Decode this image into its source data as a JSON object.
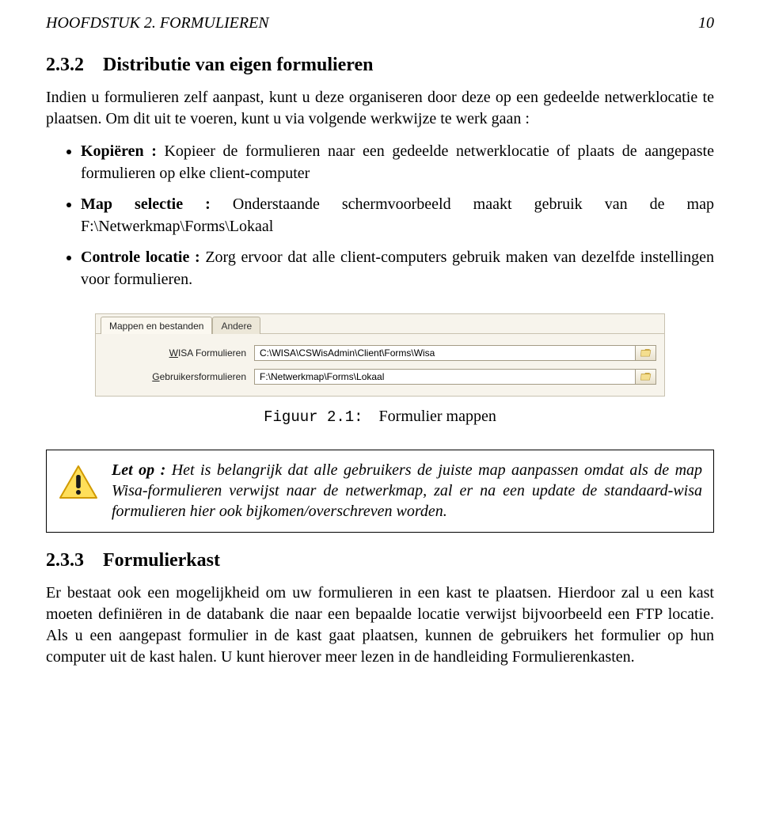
{
  "header": {
    "chapter": "HOOFDSTUK 2. FORMULIEREN",
    "page_number": "10"
  },
  "section_232": {
    "number": "2.3.2",
    "title": "Distributie van eigen formulieren",
    "intro": "Indien u formulieren zelf aanpast, kunt u deze organiseren door deze op een gedeelde netwerklocatie te plaatsen. Om dit uit te voeren, kunt u via volgende werkwijze te werk gaan :",
    "bullets": [
      {
        "label": "Kopiëren :",
        "text": " Kopieer de formulieren naar een gedeelde netwerklocatie of plaats de aangepaste formulieren op elke client-computer"
      },
      {
        "label": "Map selectie :",
        "text": " Onderstaande schermvoorbeeld maakt gebruik van de map F:\\Netwerkmap\\Forms\\Lokaal"
      },
      {
        "label": "Controle locatie :",
        "text": " Zorg ervoor dat alle client-computers gebruik maken van dezelfde instellingen voor formulieren."
      }
    ]
  },
  "screenshot": {
    "tabs": [
      "Mappen en bestanden",
      "Andere"
    ],
    "rows": [
      {
        "label_raw": "WISA Formulieren",
        "label_prefix": "W",
        "label_rest": "ISA Formulieren",
        "value": "C:\\WISA\\CSWisAdmin\\Client\\Forms\\Wisa"
      },
      {
        "label_raw": "Gebruikersformulieren",
        "label_prefix": "G",
        "label_rest": "ebruikersformulieren",
        "value": "F:\\Netwerkmap\\Forms\\Lokaal"
      }
    ]
  },
  "caption": {
    "figure": "Figuur 2.1:",
    "text": "Formulier mappen"
  },
  "warning": {
    "label": "Let op :",
    "text": " Het is belangrijk dat alle gebruikers de juiste map aanpassen omdat als de map Wisa-formulieren verwijst naar de netwerkmap, zal er na een update de standaard-wisa formulieren hier ook bijkomen/overschreven worden."
  },
  "section_233": {
    "number": "2.3.3",
    "title": "Formulierkast",
    "body": "Er bestaat ook een mogelijkheid om uw formulieren in een kast te plaatsen. Hierdoor zal u een kast moeten definiëren in de databank die naar een bepaalde locatie verwijst bijvoorbeeld een FTP locatie. Als u een aangepast formulier in de kast gaat plaatsen, kunnen de gebruikers het formulier op hun computer uit de kast halen. U kunt hierover meer lezen in de handleiding Formulierenkasten."
  }
}
